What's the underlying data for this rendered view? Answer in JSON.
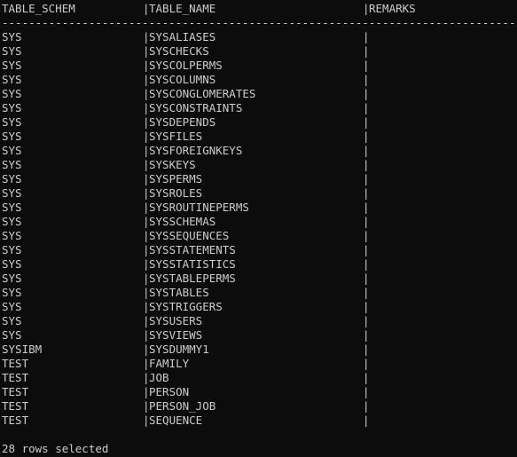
{
  "result": {
    "columns": [
      "TABLE_SCHEM",
      "TABLE_NAME",
      "REMARKS"
    ],
    "separator": "|",
    "rule": "----------------------------------------------------------------------------------------------------",
    "rows": [
      [
        "SYS",
        "SYSALIASES",
        ""
      ],
      [
        "SYS",
        "SYSCHECKS",
        ""
      ],
      [
        "SYS",
        "SYSCOLPERMS",
        ""
      ],
      [
        "SYS",
        "SYSCOLUMNS",
        ""
      ],
      [
        "SYS",
        "SYSCONGLOMERATES",
        ""
      ],
      [
        "SYS",
        "SYSCONSTRAINTS",
        ""
      ],
      [
        "SYS",
        "SYSDEPENDS",
        ""
      ],
      [
        "SYS",
        "SYSFILES",
        ""
      ],
      [
        "SYS",
        "SYSFOREIGNKEYS",
        ""
      ],
      [
        "SYS",
        "SYSKEYS",
        ""
      ],
      [
        "SYS",
        "SYSPERMS",
        ""
      ],
      [
        "SYS",
        "SYSROLES",
        ""
      ],
      [
        "SYS",
        "SYSROUTINEPERMS",
        ""
      ],
      [
        "SYS",
        "SYSSCHEMAS",
        ""
      ],
      [
        "SYS",
        "SYSSEQUENCES",
        ""
      ],
      [
        "SYS",
        "SYSSTATEMENTS",
        ""
      ],
      [
        "SYS",
        "SYSSTATISTICS",
        ""
      ],
      [
        "SYS",
        "SYSTABLEPERMS",
        ""
      ],
      [
        "SYS",
        "SYSTABLES",
        ""
      ],
      [
        "SYS",
        "SYSTRIGGERS",
        ""
      ],
      [
        "SYS",
        "SYSUSERS",
        ""
      ],
      [
        "SYS",
        "SYSVIEWS",
        ""
      ],
      [
        "SYSIBM",
        "SYSDUMMY1",
        ""
      ],
      [
        "TEST",
        "FAMILY",
        ""
      ],
      [
        "TEST",
        "JOB",
        ""
      ],
      [
        "TEST",
        "PERSON",
        ""
      ],
      [
        "TEST",
        "PERSON_JOB",
        ""
      ],
      [
        "TEST",
        "SEQUENCE",
        ""
      ]
    ],
    "status": "28 rows selected"
  },
  "colors": {
    "background": "#0c0c0c",
    "text": "#cccccc"
  }
}
